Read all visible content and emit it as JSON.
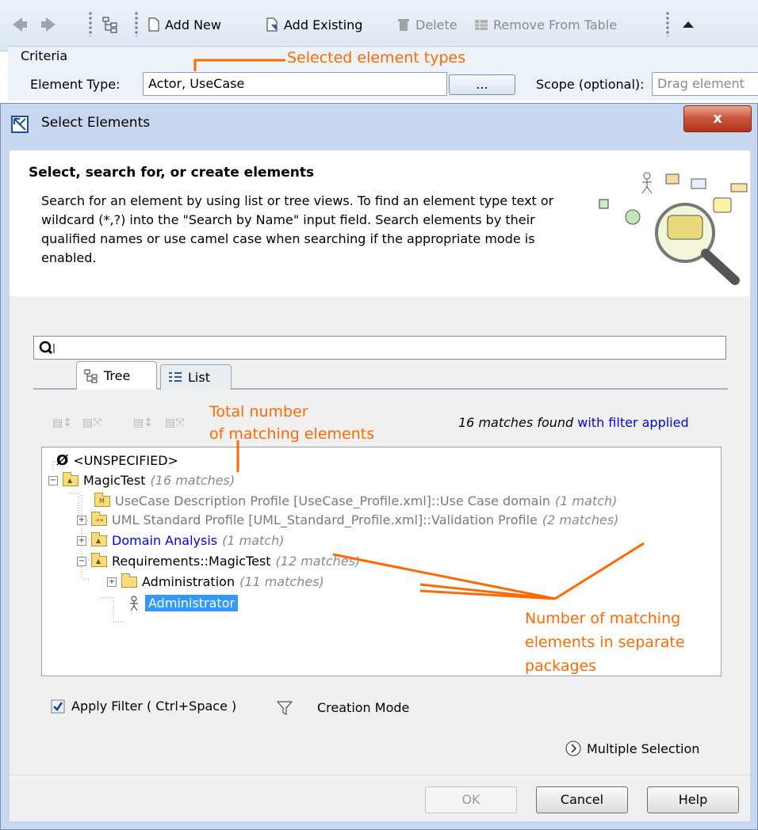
{
  "toolbar": {
    "add_new": "Add New",
    "add_existing": "Add Existing",
    "delete": "Delete",
    "remove_from_table": "Remove From Table"
  },
  "criteria": {
    "title": "Criteria",
    "element_type_label": "Element Type:",
    "element_type_value": "Actor, UseCase",
    "browse_label": "...",
    "scope_label": "Scope (optional):",
    "scope_placeholder": "Drag element"
  },
  "dialog": {
    "title": "Select Elements",
    "close_label": "x",
    "header_title": "Select, search for, or create elements",
    "header_description": "Search for an element by using list or tree views. To find an element type text or wildcard (*,?) into the \"Search by Name\" input field. Search elements by their qualified names or use camel case when searching if the appropriate mode is enabled.",
    "search_value": "",
    "tabs": [
      {
        "label": "Tree"
      },
      {
        "label": "List"
      }
    ],
    "matches_text": "16 matches found",
    "filter_applied_text": "with filter applied",
    "tree": [
      {
        "label": "<UNSPECIFIED>",
        "count": ""
      },
      {
        "label": "MagicTest",
        "count": "(16 matches)"
      },
      {
        "label": "UseCase Description Profile [UseCase_Profile.xml]::Use Case domain",
        "count": "(1 match)"
      },
      {
        "label": "UML Standard Profile [UML_Standard_Profile.xml]::Validation Profile",
        "count": "(2 matches)"
      },
      {
        "label": "Domain Analysis",
        "count": "(1 match)"
      },
      {
        "label": "Requirements::MagicTest",
        "count": "(12 matches)"
      },
      {
        "label": "Administration",
        "count": "(11 matches)"
      },
      {
        "label": "Administrator",
        "count": ""
      }
    ],
    "apply_filter_label": "Apply Filter ( Ctrl+Space )",
    "creation_mode_label": "Creation Mode",
    "multiple_selection_label": "Multiple Selection",
    "ok_label": "OK",
    "cancel_label": "Cancel",
    "help_label": "Help"
  },
  "annotations": {
    "selected_types": "Selected element types",
    "total_number_line1": "Total number",
    "total_number_line2": "of matching elements",
    "separate_line1": "Number of matching",
    "separate_line2": "elements in separate",
    "separate_line3": "packages"
  },
  "colors": {
    "annotation": "#ff6a00",
    "selection": "#3399ff",
    "link": "#0000ee"
  }
}
